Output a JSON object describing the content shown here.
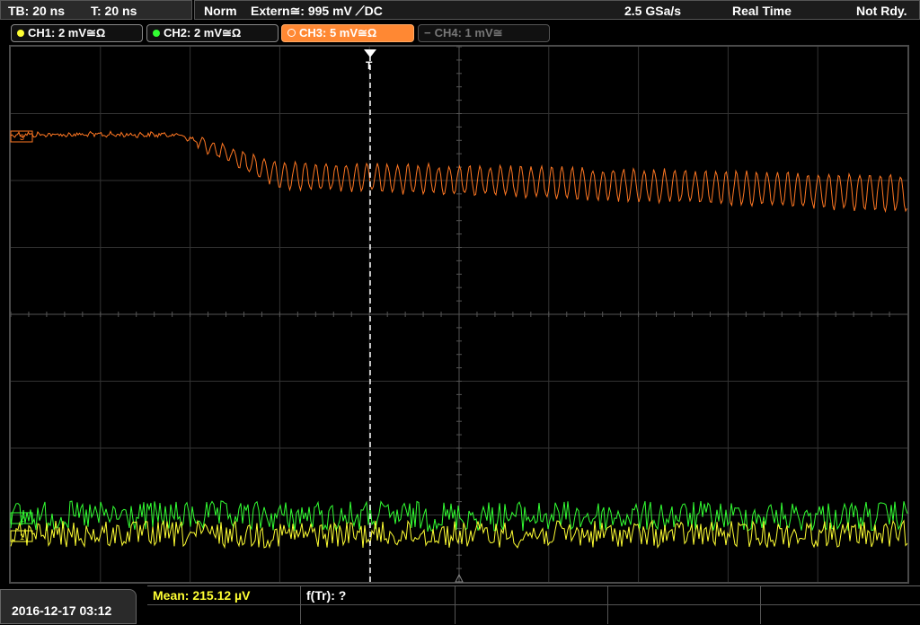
{
  "top": {
    "timebase": "TB: 20 ns",
    "trigger_time": "T: 20 ns",
    "trigger_mode": "Norm",
    "trigger_source": "Extern≅: 995 mV ⟋DC",
    "sample_rate": "2.5 GSa/s",
    "acq_mode": "Real Time",
    "status": "Not Rdy."
  },
  "channels": [
    {
      "label": "CH1: 2 mV≅Ω",
      "color": "#ffff33",
      "active": true
    },
    {
      "label": "CH2: 2 mV≅Ω",
      "color": "#33ff33",
      "active": true
    },
    {
      "label": "CH3: 5 mV≅Ω",
      "color": "#ff8833",
      "active": true
    },
    {
      "label": "CH4: 1 mV≅",
      "color": "#888888",
      "active": false
    }
  ],
  "markers": {
    "ch3": "3",
    "ch2": "2",
    "ch1": "1",
    "trigger": "T"
  },
  "bottom": {
    "datetime": "2016-12-17 03:12",
    "mean": "Mean: 215.12 µV",
    "ftr": "f(Tr): ?"
  },
  "traces": {
    "ch3_color": "#ff7722",
    "ch2_color": "#33ff33",
    "ch1_color": "#ffff33"
  }
}
